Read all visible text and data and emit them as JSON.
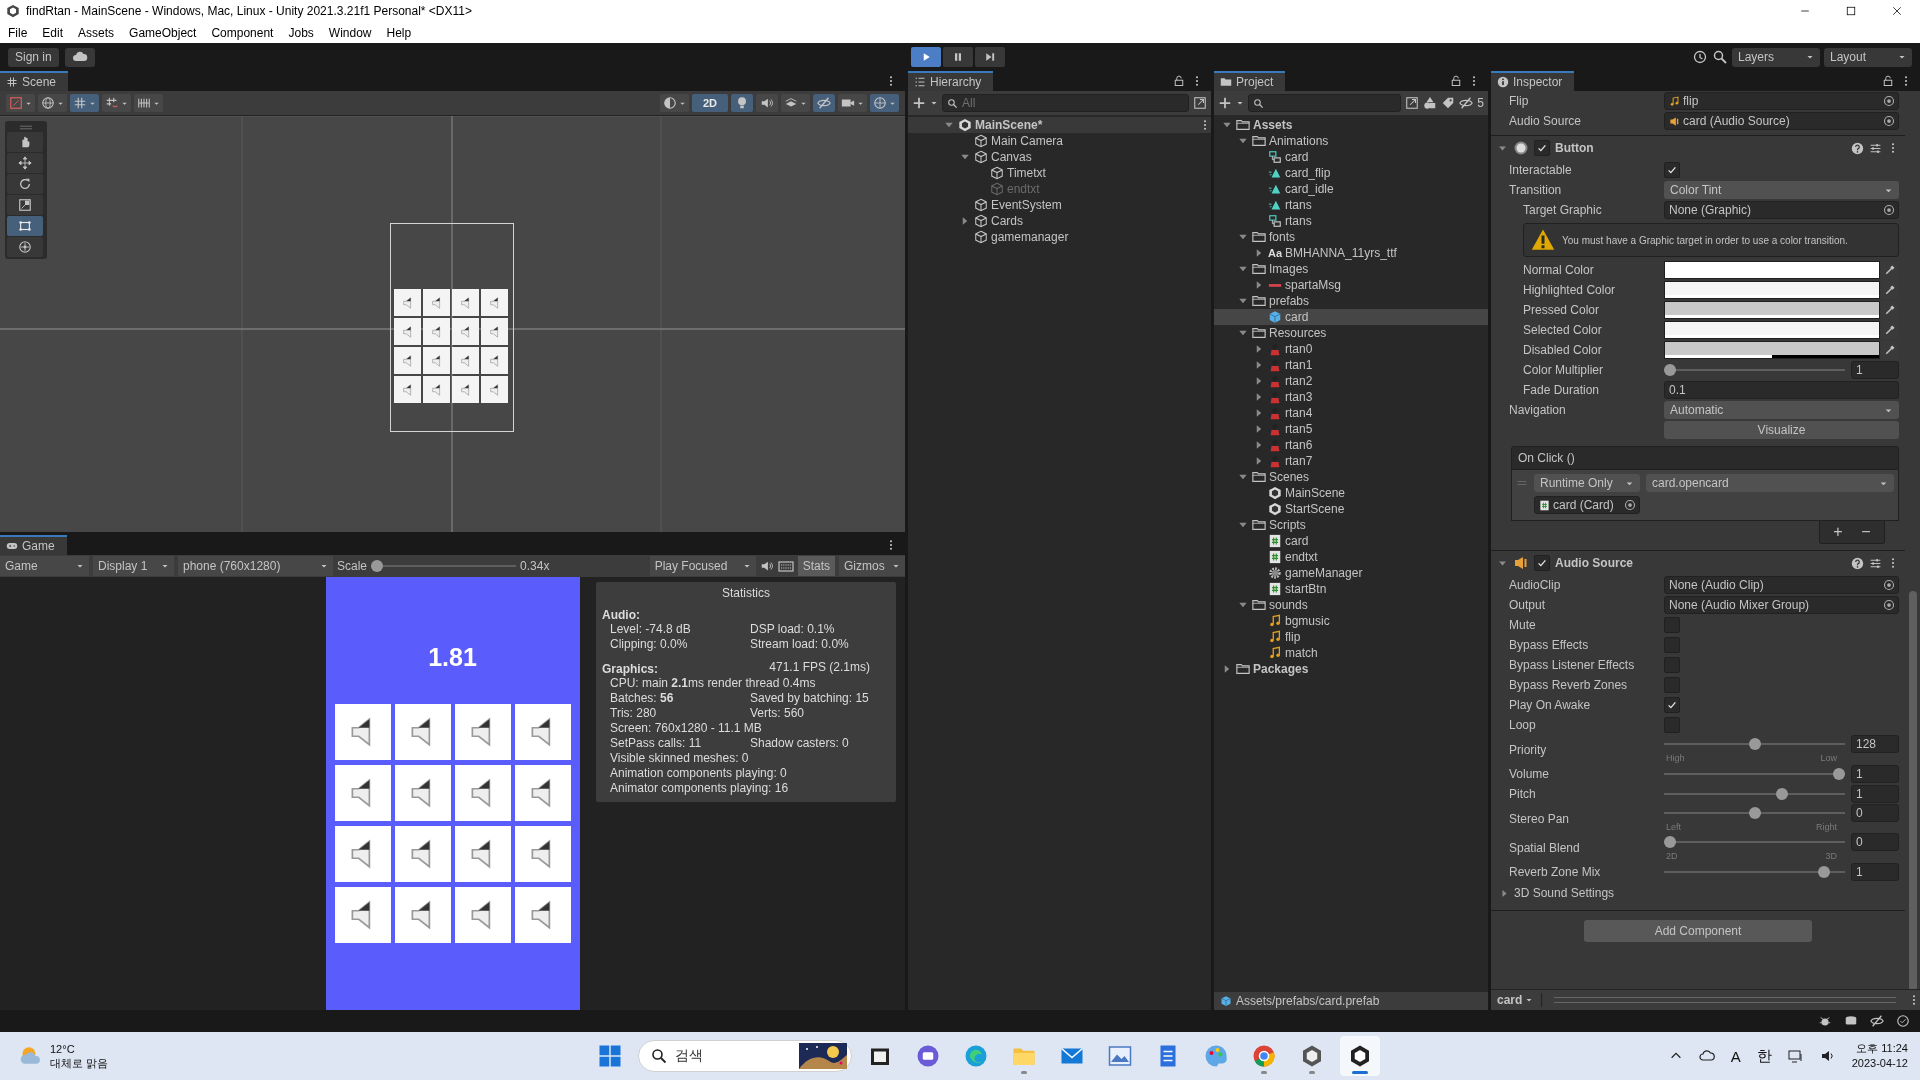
{
  "window": {
    "title": "findRtan - MainScene - Windows, Mac, Linux - Unity 2021.3.21f1 Personal* <DX11>"
  },
  "menu": [
    "File",
    "Edit",
    "Assets",
    "GameObject",
    "Component",
    "Jobs",
    "Window",
    "Help"
  ],
  "toolbar": {
    "sign_in": "Sign in",
    "playback": [
      {
        "kind": "play",
        "selected": true
      },
      {
        "kind": "pause",
        "selected": false
      },
      {
        "kind": "step",
        "selected": false
      }
    ],
    "layers": "Layers",
    "layout": "Layout"
  },
  "scene": {
    "tab": "Scene",
    "toolbar_left": [
      {
        "kind": "gizmo",
        "selected": false
      },
      {
        "kind": "globe",
        "selected": false
      },
      {
        "kind": "grid",
        "selected": true
      },
      {
        "kind": "snap",
        "selected": false
      },
      {
        "kind": "increment",
        "selected": false
      }
    ],
    "toolbar_right": [
      {
        "kind": "shading",
        "selected": false
      },
      {
        "kind": "dimension",
        "label": "2D",
        "selected": true
      },
      {
        "kind": "light",
        "selected": true
      },
      {
        "kind": "audio",
        "selected": false
      },
      {
        "kind": "effects",
        "selected": false
      },
      {
        "kind": "hidden",
        "selected": true
      },
      {
        "kind": "camera",
        "selected": false
      },
      {
        "kind": "gizmos",
        "selected": true
      }
    ],
    "tools": [
      {
        "kind": "hand",
        "selected": false
      },
      {
        "kind": "move",
        "selected": false
      },
      {
        "kind": "rotate",
        "selected": false
      },
      {
        "kind": "scale",
        "selected": false
      },
      {
        "kind": "rect",
        "selected": true
      },
      {
        "kind": "transform",
        "selected": false
      }
    ]
  },
  "game": {
    "tab": "Game",
    "view": "Game",
    "display": "Display 1",
    "resolution": "phone (760x1280)",
    "scale": {
      "label": "Scale",
      "level": 0,
      "reading": "0.34x"
    },
    "play_mode": "Play Focused",
    "stats": {
      "label": "Stats",
      "selected": true
    },
    "gizmos": "Gizmos",
    "timer": "1.81",
    "statistics": {
      "title": "Statistics",
      "audio_heading": "Audio:",
      "audio": [
        [
          "Level: -74.8 dB",
          "DSP load: 0.1%"
        ],
        [
          "Clipping: 0.0%",
          "Stream load: 0.0%"
        ]
      ],
      "graphics_heading": "Graphics:",
      "fps": "471.1 FPS (2.1ms)",
      "graphics": [
        [
          "CPU: main **2.1**ms  render thread 0.4ms"
        ],
        [
          "Batches: **56**",
          "Saved by batching: 15"
        ],
        [
          "Tris: 280",
          "Verts: 560"
        ],
        [
          "Screen: 760x1280 - 11.1 MB"
        ],
        [
          "SetPass calls: 11",
          "Shadow casters: 0"
        ],
        [
          "Visible skinned meshes: 0"
        ],
        [
          "Animation components playing: 0"
        ],
        [
          "Animator components playing: 16"
        ]
      ]
    }
  },
  "hierarchy": {
    "tab": "Hierarchy",
    "search": {
      "placeholder": "All"
    },
    "tree": [
      {
        "label": "MainScene*",
        "kind": "scene",
        "expanded": true,
        "children": [
          {
            "label": "Main Camera",
            "kind": "object",
            "disabled": false
          },
          {
            "label": "Canvas",
            "kind": "object",
            "disabled": false,
            "expanded": true,
            "children": [
              {
                "label": "Timetxt",
                "kind": "object",
                "disabled": false
              },
              {
                "label": "endtxt",
                "kind": "object",
                "disabled": true
              }
            ]
          },
          {
            "label": "EventSystem",
            "kind": "object",
            "disabled": false
          },
          {
            "label": "Cards",
            "kind": "object",
            "disabled": false,
            "expanded": false
          },
          {
            "label": "gamemanager",
            "kind": "object",
            "disabled": false
          }
        ]
      }
    ]
  },
  "project": {
    "tab": "Project",
    "hidden_count": "5",
    "path": "Assets/prefabs/card.prefab",
    "tree": [
      {
        "label": "Assets",
        "kind": "folder",
        "expanded": true,
        "selected": false,
        "children": [
          {
            "label": "Animations",
            "kind": "folder",
            "expanded": true,
            "selected": false,
            "children": [
              {
                "label": "card",
                "kind": "animator",
                "selected": false
              },
              {
                "label": "card_flip",
                "kind": "anim",
                "selected": false
              },
              {
                "label": "card_idle",
                "kind": "anim",
                "selected": false
              },
              {
                "label": "rtans",
                "kind": "anim",
                "selected": false
              },
              {
                "label": "rtans",
                "kind": "animator",
                "selected": false
              }
            ]
          },
          {
            "label": "fonts",
            "kind": "folder",
            "expanded": true,
            "selected": false,
            "children": [
              {
                "label": "BMHANNA_11yrs_ttf",
                "kind": "font",
                "icon_text": "Aa",
                "expanded": false,
                "selected": false
              }
            ]
          },
          {
            "label": "Images",
            "kind": "folder",
            "expanded": true,
            "selected": false,
            "children": [
              {
                "label": "spartaMsg",
                "kind": "sprite",
                "expanded": false,
                "selected": false
              }
            ]
          },
          {
            "label": "prefabs",
            "kind": "folder",
            "expanded": true,
            "selected": false,
            "children": [
              {
                "label": "card",
                "kind": "prefab",
                "selected": true
              }
            ]
          },
          {
            "label": "Resources",
            "kind": "folder",
            "expanded": true,
            "selected": false,
            "children": [
              {
                "label": "rtan0",
                "kind": "texture",
                "expanded": false,
                "selected": false
              },
              {
                "label": "rtan1",
                "kind": "texture",
                "expanded": false,
                "selected": false
              },
              {
                "label": "rtan2",
                "kind": "texture",
                "expanded": false,
                "selected": false
              },
              {
                "label": "rtan3",
                "kind": "texture",
                "expanded": false,
                "selected": false
              },
              {
                "label": "rtan4",
                "kind": "texture",
                "expanded": false,
                "selected": false
              },
              {
                "label": "rtan5",
                "kind": "texture",
                "expanded": false,
                "selected": false
              },
              {
                "label": "rtan6",
                "kind": "texture",
                "expanded": false,
                "selected": false
              },
              {
                "label": "rtan7",
                "kind": "texture",
                "expanded": false,
                "selected": false
              }
            ]
          },
          {
            "label": "Scenes",
            "kind": "folder",
            "expanded": true,
            "selected": false,
            "children": [
              {
                "label": "MainScene",
                "kind": "scene",
                "selected": false
              },
              {
                "label": "StartScene",
                "kind": "scene",
                "selected": false
              }
            ]
          },
          {
            "label": "Scripts",
            "kind": "folder",
            "expanded": true,
            "selected": false,
            "children": [
              {
                "label": "card",
                "kind": "script",
                "selected": false
              },
              {
                "label": "endtxt",
                "kind": "script",
                "selected": false
              },
              {
                "label": "gameManager",
                "kind": "settings",
                "selected": false
              },
              {
                "label": "startBtn",
                "kind": "script",
                "selected": false
              }
            ]
          },
          {
            "label": "sounds",
            "kind": "folder",
            "expanded": true,
            "selected": false,
            "children": [
              {
                "label": "bgmusic",
                "kind": "audio",
                "selected": false
              },
              {
                "label": "flip",
                "kind": "audio",
                "selected": false
              },
              {
                "label": "match",
                "kind": "audio",
                "selected": false
              }
            ]
          }
        ]
      },
      {
        "label": "Packages",
        "kind": "folder",
        "expanded": false,
        "selected": false
      }
    ]
  },
  "inspector": {
    "tab": "Inspector",
    "rows": [
      {
        "kind": "object",
        "label": "Flip",
        "value": "flip",
        "reference": {
          "kind": "clip"
        }
      },
      {
        "kind": "object",
        "label": "Audio Source",
        "value": "card (Audio Source)",
        "reference": {
          "kind": "source"
        }
      }
    ],
    "components": [
      {
        "kind": "button",
        "title": "Button",
        "enabled": true,
        "expanded": true,
        "rows": [
          {
            "kind": "checkbox",
            "label": "Interactable",
            "checked": true
          },
          {
            "kind": "dropdown",
            "label": "Transition",
            "value": "Color Tint",
            "children": [
              {
                "kind": "object",
                "label": "Target Graphic",
                "value": "None (Graphic)"
              },
              {
                "kind": "help",
                "text": "You must have a Graphic target in order to use a color transition."
              },
              {
                "kind": "color",
                "label": "Normal Color",
                "color": "#ffffff",
                "level": 1
              },
              {
                "kind": "color",
                "label": "Highlighted Color",
                "color": "#f5f5f5",
                "level": 1
              },
              {
                "kind": "color",
                "label": "Pressed Color",
                "color": "#c8c8c8",
                "level": 1
              },
              {
                "kind": "color",
                "label": "Selected Color",
                "color": "#f5f5f5",
                "level": 1
              },
              {
                "kind": "color",
                "label": "Disabled Color",
                "color": "#c8c8c8",
                "level": 0.5
              },
              {
                "kind": "slider",
                "label": "Color Multiplier",
                "level": 0,
                "value": "1"
              },
              {
                "kind": "field",
                "label": "Fade Duration",
                "value": "0.1"
              }
            ]
          },
          {
            "kind": "dropdown",
            "label": "Navigation",
            "value": "Automatic"
          },
          {
            "kind": "button",
            "label": "Visualize"
          },
          {
            "kind": "event",
            "label": "On Click ()",
            "calls": [
              {
                "mode": "Runtime Only",
                "function": "card.opencard",
                "target": "card (Card)"
              }
            ],
            "add": "+",
            "remove": "−"
          }
        ]
      },
      {
        "kind": "audio_source",
        "title": "Audio Source",
        "enabled": true,
        "expanded": true,
        "rows": [
          {
            "kind": "object",
            "label": "AudioClip",
            "value": "None (Audio Clip)"
          },
          {
            "kind": "object",
            "label": "Output",
            "value": "None (Audio Mixer Group)"
          },
          {
            "kind": "checkbox",
            "label": "Mute",
            "checked": false
          },
          {
            "kind": "checkbox",
            "label": "Bypass Effects",
            "checked": false
          },
          {
            "kind": "checkbox",
            "label": "Bypass Listener Effects",
            "checked": false
          },
          {
            "kind": "checkbox",
            "label": "Bypass Reverb Zones",
            "checked": false
          },
          {
            "kind": "checkbox",
            "label": "Play On Awake",
            "checked": true
          },
          {
            "kind": "checkbox",
            "label": "Loop",
            "checked": false
          },
          {
            "kind": "slider",
            "label": "Priority",
            "level": 0.5,
            "value": "128",
            "left": "High",
            "right": "Low"
          },
          {
            "kind": "slider",
            "label": "Volume",
            "level": 1,
            "value": "1"
          },
          {
            "kind": "slider",
            "label": "Pitch",
            "level": 0.66,
            "value": "1"
          },
          {
            "kind": "slider",
            "label": "Stereo Pan",
            "level": 0.5,
            "value": "0",
            "left": "Left",
            "right": "Right"
          },
          {
            "kind": "slider",
            "label": "Spatial Blend",
            "level": 0,
            "value": "0",
            "left": "2D",
            "right": "3D"
          },
          {
            "kind": "slider",
            "label": "Reverb Zone Mix",
            "level": 0.91,
            "value": "1"
          },
          {
            "kind": "foldout",
            "label": "3D Sound Settings",
            "expanded": false
          }
        ]
      }
    ],
    "add_component": "Add Component",
    "footer": "card"
  },
  "taskbar": {
    "weather": {
      "temp": "12°C",
      "condition": "대체로 맑음"
    },
    "search": {
      "placeholder": "검색"
    },
    "apps": [
      {
        "kind": "files",
        "running": false,
        "selected": false
      },
      {
        "kind": "chat",
        "running": false,
        "selected": false
      },
      {
        "kind": "edge",
        "running": false,
        "selected": false
      },
      {
        "kind": "explorer",
        "running": true,
        "selected": false
      },
      {
        "kind": "mail",
        "running": false,
        "selected": false
      },
      {
        "kind": "photos",
        "running": false,
        "selected": false
      },
      {
        "kind": "notepad",
        "running": false,
        "selected": false
      },
      {
        "kind": "paint",
        "running": false,
        "selected": false
      },
      {
        "kind": "chrome",
        "running": true,
        "selected": false
      },
      {
        "kind": "unity_hub",
        "running": true,
        "selected": false
      },
      {
        "kind": "unity",
        "running": true,
        "selected": true
      }
    ],
    "tray": [
      "A",
      "한"
    ],
    "clock": {
      "time": "오후 11:24",
      "date": "2023-04-12"
    }
  }
}
